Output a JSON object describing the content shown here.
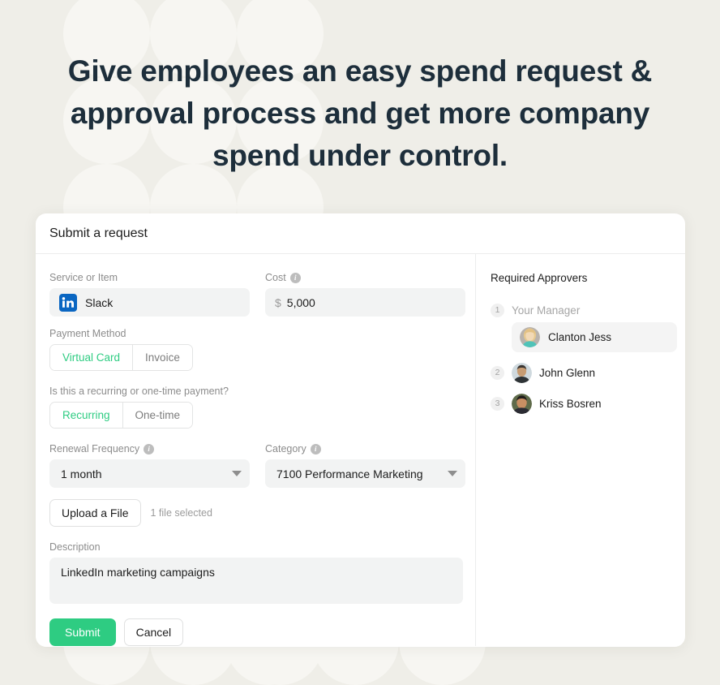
{
  "hero": {
    "headline": "Give employees an easy spend request & approval process and get more company spend under control."
  },
  "card": {
    "header_title": "Submit a request",
    "form": {
      "service": {
        "label": "Service or Item",
        "value": "Slack",
        "icon": "linkedin-icon"
      },
      "cost": {
        "label": "Cost",
        "currency_symbol": "$",
        "value": "5,000",
        "info_icon": "info-icon"
      },
      "payment_method": {
        "label": "Payment Method",
        "options": [
          "Virtual Card",
          "Invoice"
        ],
        "selected": "Virtual Card"
      },
      "recurrence": {
        "label": "Is this a recurring or one-time payment?",
        "options": [
          "Recurring",
          "One-time"
        ],
        "selected": "Recurring"
      },
      "renewal_frequency": {
        "label": "Renewal Frequency",
        "value": "1 month",
        "info_icon": "info-icon",
        "caret_icon": "caret-down-icon"
      },
      "category": {
        "label": "Category",
        "value": "7100 Performance Marketing",
        "info_icon": "info-icon",
        "caret_icon": "caret-down-icon"
      },
      "upload": {
        "button_label": "Upload a File",
        "status": "1 file selected"
      },
      "description": {
        "label": "Description",
        "value": "LinkedIn marketing campaigns"
      },
      "actions": {
        "submit_label": "Submit",
        "cancel_label": "Cancel"
      }
    },
    "approvers": {
      "title": "Required Approvers",
      "items": [
        {
          "number": "1",
          "group_label": "Your Manager",
          "name": "Clanton Jess",
          "highlighted": true,
          "avatar": "avatar-clanton-jess"
        },
        {
          "number": "2",
          "group_label": "",
          "name": "John Glenn",
          "highlighted": false,
          "avatar": "avatar-john-glenn"
        },
        {
          "number": "3",
          "group_label": "",
          "name": "Kriss Bosren",
          "highlighted": false,
          "avatar": "avatar-kriss-bosren"
        }
      ]
    }
  },
  "colors": {
    "page_background": "#efeee8",
    "circle_pattern": "#f7f6f2",
    "headline_text": "#1d2e3b",
    "accent_green": "#2ecc82",
    "card_background": "#ffffff",
    "input_background": "#f2f3f3",
    "linkedin_blue": "#0a66c2"
  }
}
